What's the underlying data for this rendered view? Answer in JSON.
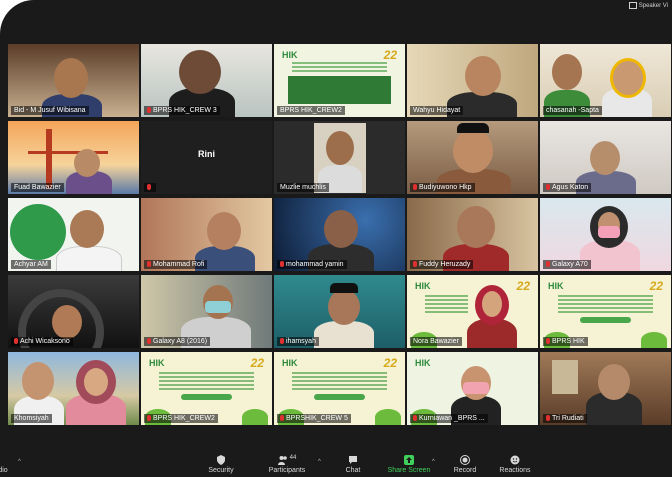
{
  "window": {
    "speaker_view_label": "Speaker Vi"
  },
  "tiles": [
    {
      "name": "Bid - M Jusuf Wibisana",
      "muted": false
    },
    {
      "name": "BPRS HIK_CREW 3",
      "muted": true
    },
    {
      "name": "BPRS HIK_CREW2",
      "muted": false
    },
    {
      "name": "Wahyu Hidayat",
      "muted": false
    },
    {
      "name": "chasanah -Sapta",
      "muted": false
    },
    {
      "name": "Fuad Bawazier",
      "muted": false
    },
    {
      "name": "Rini",
      "muted": true,
      "display_name": "Rini"
    },
    {
      "name": "Muzlie muchlis",
      "muted": false
    },
    {
      "name": "Budiyuwono Hkp",
      "muted": true
    },
    {
      "name": "Agus Katon",
      "muted": true
    },
    {
      "name": "Achyar AM",
      "muted": false
    },
    {
      "name": "Mohammad Rofi",
      "muted": true
    },
    {
      "name": "mohammad yamin",
      "muted": true
    },
    {
      "name": "Fuddy Heruzady",
      "muted": true
    },
    {
      "name": "Galaxy A70",
      "muted": true
    },
    {
      "name": "Achi Wicaksono",
      "muted": true
    },
    {
      "name": "Galaxy A8 (2016)",
      "muted": true
    },
    {
      "name": "ihamsyah",
      "muted": true
    },
    {
      "name": "Nora Bawazier",
      "muted": false
    },
    {
      "name": "BPRS HIK",
      "muted": true
    },
    {
      "name": "Khomsiyah",
      "muted": false
    },
    {
      "name": "BPRS HIK_CREW2",
      "muted": true
    },
    {
      "name": "BPRSHIK_CREW 5",
      "muted": true
    },
    {
      "name": "Kurniawan _BPRS ...",
      "muted": true
    },
    {
      "name": "Tri Rudiati",
      "muted": true
    }
  ],
  "banner": {
    "logo": "HIK",
    "anniversary": "22"
  },
  "toolbar": {
    "audio_label": "dio",
    "security_label": "Security",
    "participants_label": "Participants",
    "participants_count": "44",
    "chat_label": "Chat",
    "share_label": "Share Screen",
    "record_label": "Record",
    "reactions_label": "Reactions"
  },
  "colors": {
    "active_speaker": "#f3e44a",
    "share_green": "#3fcf5a",
    "muted_red": "#e03030",
    "window_bg": "#1a1a1a"
  }
}
